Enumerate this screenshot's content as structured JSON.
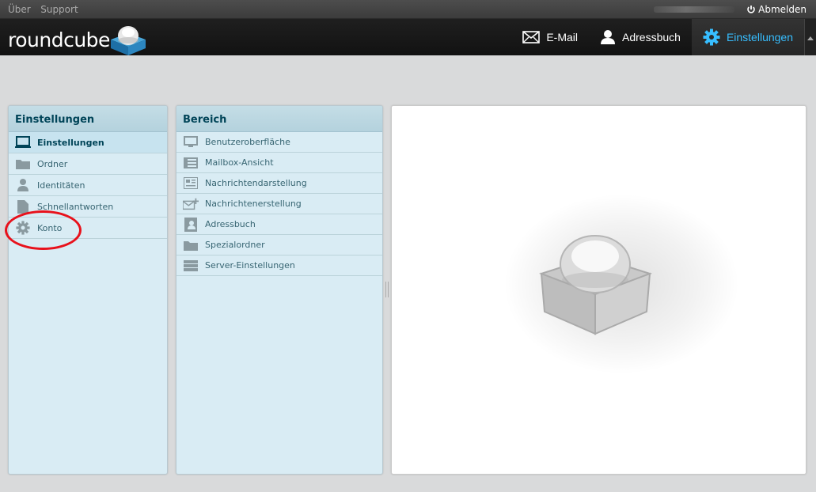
{
  "topline": {
    "links": [
      "Über",
      "Support"
    ],
    "logout_label": "Abmelden"
  },
  "header": {
    "logo_text": "roundcube",
    "nav": [
      {
        "label": "E-Mail",
        "icon": "mail-icon"
      },
      {
        "label": "Adressbuch",
        "icon": "person-icon"
      },
      {
        "label": "Einstellungen",
        "icon": "gear-icon",
        "active": true
      }
    ]
  },
  "settings_panel": {
    "title": "Einstellungen",
    "items": [
      {
        "label": "Einstellungen",
        "icon": "monitor-icon",
        "selected": true
      },
      {
        "label": "Ordner",
        "icon": "folder-icon"
      },
      {
        "label": "Identitäten",
        "icon": "identity-icon"
      },
      {
        "label": "Schnellantworten",
        "icon": "document-icon"
      },
      {
        "label": "Konto",
        "icon": "gear-icon"
      }
    ]
  },
  "section_panel": {
    "title": "Bereich",
    "items": [
      {
        "label": "Benutzeroberfläche",
        "icon": "monitor-icon"
      },
      {
        "label": "Mailbox-Ansicht",
        "icon": "mailbox-view-icon"
      },
      {
        "label": "Nachrichtendarstellung",
        "icon": "message-display-icon"
      },
      {
        "label": "Nachrichtenerstellung",
        "icon": "compose-mail-icon"
      },
      {
        "label": "Adressbuch",
        "icon": "addressbook-icon"
      },
      {
        "label": "Spezialordner",
        "icon": "folder-icon"
      },
      {
        "label": "Server-Einstellungen",
        "icon": "server-icon"
      }
    ]
  },
  "colors": {
    "accent": "#37beff",
    "annotation": "#e8111b",
    "panel_bg": "#d9ecf4"
  }
}
